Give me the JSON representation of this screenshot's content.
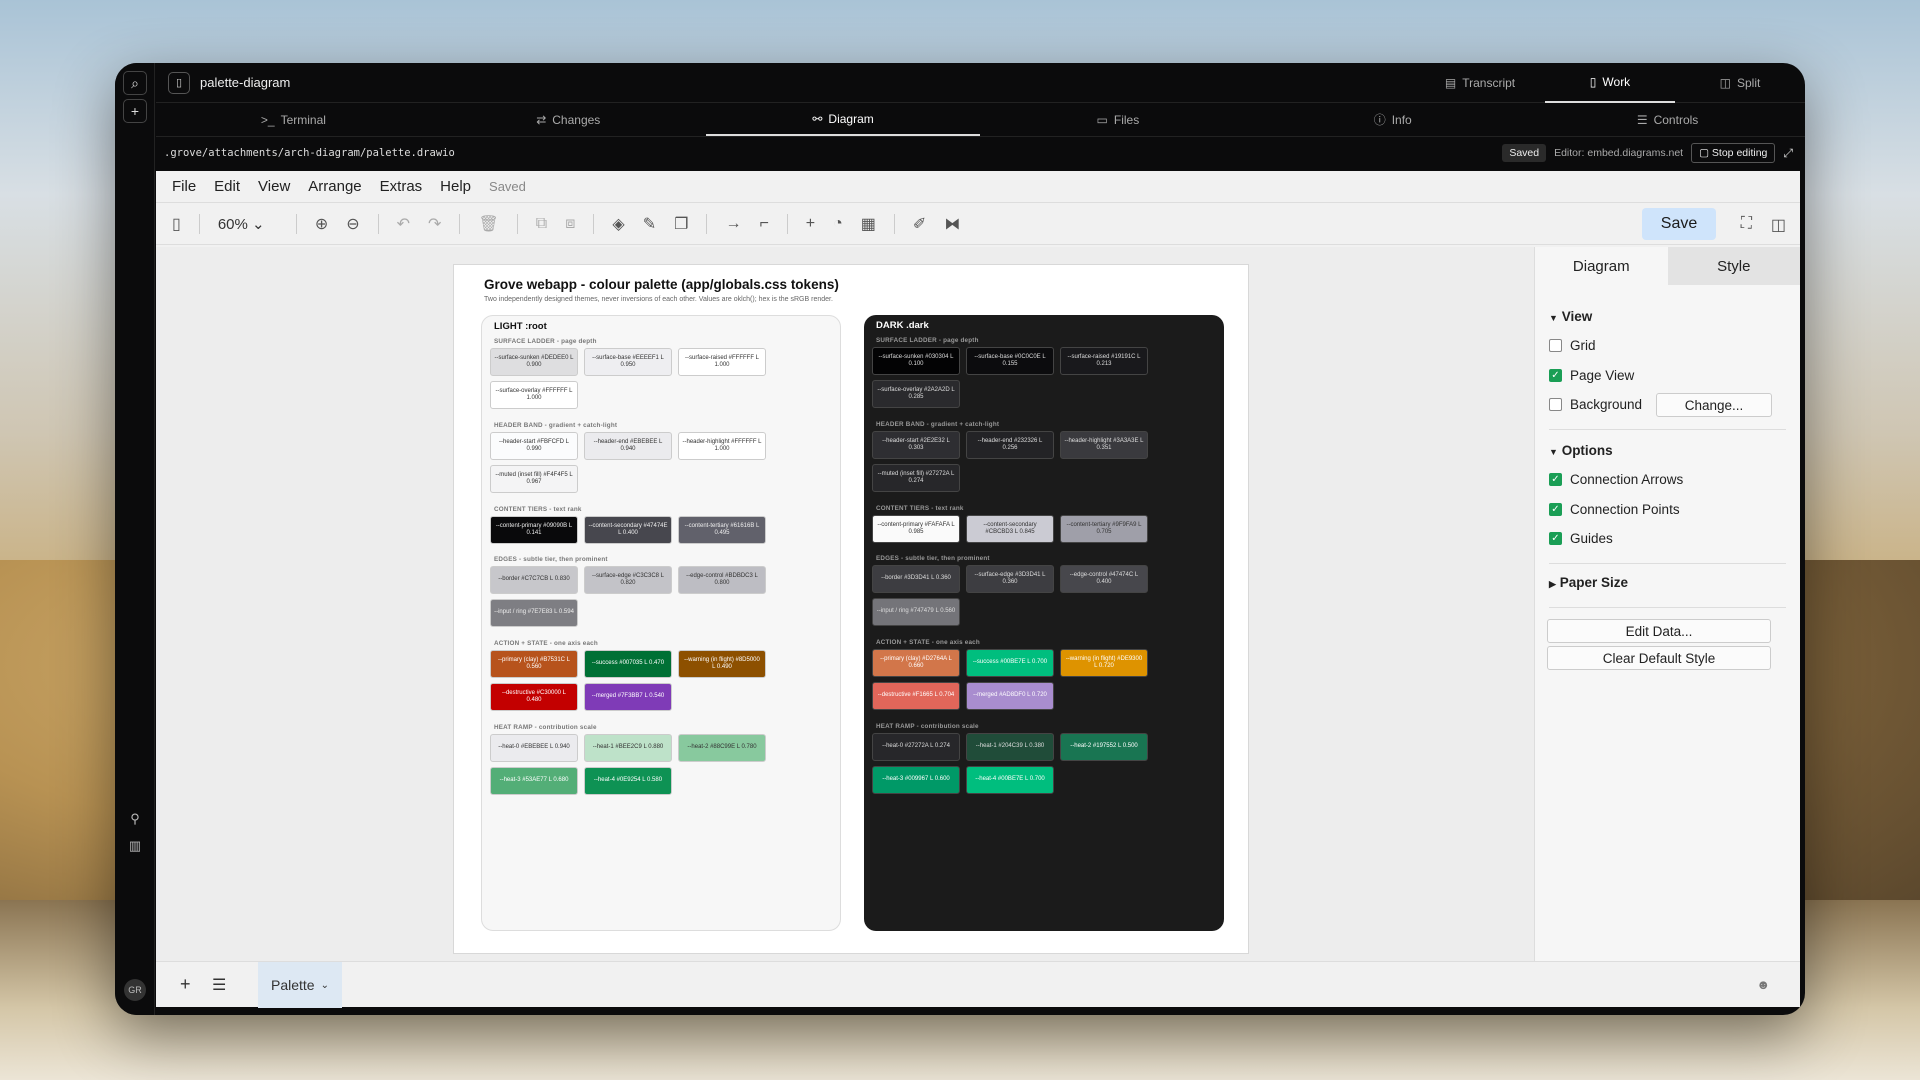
{
  "window": {
    "title": "palette-diagram"
  },
  "view_tabs": [
    {
      "label": "Transcript",
      "icon": "transcript-icon"
    },
    {
      "label": "Work",
      "icon": "work-icon",
      "active": true
    },
    {
      "label": "Split",
      "icon": "split-icon"
    }
  ],
  "tabs": [
    {
      "label": "Terminal",
      "icon": "terminal-icon"
    },
    {
      "label": "Changes",
      "icon": "changes-icon"
    },
    {
      "label": "Diagram",
      "icon": "diagram-icon",
      "active": true
    },
    {
      "label": "Files",
      "icon": "file-icon"
    },
    {
      "label": "Info",
      "icon": "info-icon"
    },
    {
      "label": "Controls",
      "icon": "controls-icon"
    }
  ],
  "path": {
    "file_path": ".grove/attachments/arch-diagram/palette.drawio",
    "saved_badge": "Saved",
    "editor_label": "Editor: embed.diagrams.net",
    "stop_label": "Stop editing"
  },
  "menu": {
    "items": [
      "File",
      "Edit",
      "View",
      "Arrange",
      "Extras",
      "Help"
    ],
    "status": "Saved"
  },
  "toolbar": {
    "zoom": "60%",
    "save_label": "Save"
  },
  "diagram": {
    "title": "Grove webapp - colour palette (app/globals.css tokens)",
    "subtitle": "Two independently designed themes, never inversions of each other. Values are oklch(); hex is the sRGB render.",
    "light": {
      "title": "LIGHT :root",
      "sections": [
        {
          "label": "SURFACE LADDER - page depth",
          "swatches": [
            {
              "text": "--surface-sunken #DEDEE0 L 0.900",
              "bg": "#DEDEE0",
              "fg": "#333"
            },
            {
              "text": "--surface-base #EEEEF1 L 0.950",
              "bg": "#EEEEF1",
              "fg": "#333"
            },
            {
              "text": "--surface-raised #FFFFFF L 1.000",
              "bg": "#FFFFFF",
              "fg": "#333"
            },
            {
              "text": "--surface-overlay #FFFFFF L 1.000",
              "bg": "#FFFFFF",
              "fg": "#333"
            }
          ]
        },
        {
          "label": "HEADER BAND - gradient + catch-light",
          "swatches": [
            {
              "text": "--header-start #FBFCFD L 0.990",
              "bg": "#FBFCFD",
              "fg": "#333"
            },
            {
              "text": "--header-end #EBEBEE L 0.940",
              "bg": "#EBEBEE",
              "fg": "#333"
            },
            {
              "text": "--header-highlight #FFFFFF L 1.000",
              "bg": "#FFFFFF",
              "fg": "#333"
            },
            {
              "text": "--muted (inset fill) #F4F4F5 L 0.967",
              "bg": "#F4F4F5",
              "fg": "#333"
            }
          ]
        },
        {
          "label": "CONTENT TIERS - text rank",
          "swatches": [
            {
              "text": "--content-primary #09090B L 0.141",
              "bg": "#09090B",
              "fg": "#eee"
            },
            {
              "text": "--content-secondary #47474E L 0.400",
              "bg": "#47474E",
              "fg": "#eee"
            },
            {
              "text": "--content-tertiary #61616B L 0.495",
              "bg": "#61616B",
              "fg": "#eee"
            }
          ]
        },
        {
          "label": "EDGES - subtle tier, then prominent",
          "swatches": [
            {
              "text": "--border #C7C7CB L 0.830",
              "bg": "#C7C7CB",
              "fg": "#333"
            },
            {
              "text": "--surface-edge #C3C3C8 L 0.820",
              "bg": "#C3C3C8",
              "fg": "#333"
            },
            {
              "text": "--edge-control #BDBDC3 L 0.800",
              "bg": "#BDBDC3",
              "fg": "#333"
            },
            {
              "text": "--input / ring #7E7E83 L 0.594",
              "bg": "#7E7E83",
              "fg": "#eee"
            }
          ]
        },
        {
          "label": "ACTION + STATE - one axis each",
          "swatches": [
            {
              "text": "--primary (clay) #B7531C L 0.560",
              "bg": "#B7531C",
              "fg": "#fff"
            },
            {
              "text": "--success #007035 L 0.470",
              "bg": "#007035",
              "fg": "#fff"
            },
            {
              "text": "--warning (in flight) #8D5000 L 0.490",
              "bg": "#8D5000",
              "fg": "#fff"
            },
            {
              "text": "--destructive #C30000 L 0.480",
              "bg": "#C30000",
              "fg": "#fff"
            },
            {
              "text": "--merged #7F3BB7 L 0.540",
              "bg": "#7F3BB7",
              "fg": "#fff"
            }
          ]
        },
        {
          "label": "HEAT RAMP - contribution scale",
          "swatches": [
            {
              "text": "--heat-0 #EBEBEE L 0.940",
              "bg": "#EBEBEE",
              "fg": "#333"
            },
            {
              "text": "--heat-1 #BEE2C9 L 0.880",
              "bg": "#BEE2C9",
              "fg": "#333"
            },
            {
              "text": "--heat-2 #88C99E L 0.780",
              "bg": "#88C99E",
              "fg": "#333"
            },
            {
              "text": "--heat-3 #53AE77 L 0.680",
              "bg": "#53AE77",
              "fg": "#fff"
            },
            {
              "text": "--heat-4 #0E9254 L 0.580",
              "bg": "#0E9254",
              "fg": "#fff"
            }
          ]
        }
      ]
    },
    "dark": {
      "title": "DARK .dark",
      "sections": [
        {
          "label": "SURFACE LADDER - page depth",
          "swatches": [
            {
              "text": "--surface-sunken #030304 L 0.100",
              "bg": "#030304",
              "fg": "#ddd"
            },
            {
              "text": "--surface-base #0C0C0E L 0.155",
              "bg": "#0C0C0E",
              "fg": "#ddd"
            },
            {
              "text": "--surface-raised #19191C L 0.213",
              "bg": "#19191C",
              "fg": "#ddd"
            },
            {
              "text": "--surface-overlay #2A2A2D L 0.285",
              "bg": "#2A2A2D",
              "fg": "#ddd"
            }
          ]
        },
        {
          "label": "HEADER BAND - gradient + catch-light",
          "swatches": [
            {
              "text": "--header-start #2E2E32 L 0.303",
              "bg": "#2E2E32",
              "fg": "#ddd"
            },
            {
              "text": "--header-end #232326 L 0.256",
              "bg": "#232326",
              "fg": "#ddd"
            },
            {
              "text": "--header-highlight #3A3A3E L 0.351",
              "bg": "#3A3A3E",
              "fg": "#ddd"
            },
            {
              "text": "--muted (inset fill) #27272A L 0.274",
              "bg": "#27272A",
              "fg": "#ddd"
            }
          ]
        },
        {
          "label": "CONTENT TIERS - text rank",
          "swatches": [
            {
              "text": "--content-primary #FAFAFA L 0.985",
              "bg": "#FAFAFA",
              "fg": "#333"
            },
            {
              "text": "--content-secondary #CBCBD3 L 0.845",
              "bg": "#CBCBD3",
              "fg": "#333"
            },
            {
              "text": "--content-tertiary #9F9FA9 L 0.705",
              "bg": "#9F9FA9",
              "fg": "#333"
            }
          ]
        },
        {
          "label": "EDGES - subtle tier, then prominent",
          "swatches": [
            {
              "text": "--border #3D3D41 L 0.360",
              "bg": "#3D3D41",
              "fg": "#ddd"
            },
            {
              "text": "--surface-edge #3D3D41 L 0.360",
              "bg": "#3D3D41",
              "fg": "#ddd"
            },
            {
              "text": "--edge-control #47474C L 0.400",
              "bg": "#47474C",
              "fg": "#ddd"
            },
            {
              "text": "--input / ring #747479 L 0.560",
              "bg": "#747479",
              "fg": "#ddd"
            }
          ]
        },
        {
          "label": "ACTION + STATE - one axis each",
          "swatches": [
            {
              "text": "--primary (clay) #D2764A L 0.660",
              "bg": "#D2764A",
              "fg": "#fff"
            },
            {
              "text": "--success #00BE7E L 0.700",
              "bg": "#00BE7E",
              "fg": "#fff"
            },
            {
              "text": "--warning (in flight) #DE9300 L 0.720",
              "bg": "#DE9300",
              "fg": "#fff"
            },
            {
              "text": "--destructive #F1665 L 0.704",
              "bg": "#E1665A",
              "fg": "#fff"
            },
            {
              "text": "--merged #AD8DF0 L 0.720",
              "bg": "#A98DCF",
              "fg": "#fff"
            }
          ]
        },
        {
          "label": "HEAT RAMP - contribution scale",
          "swatches": [
            {
              "text": "--heat-0 #27272A L 0.274",
              "bg": "#27272A",
              "fg": "#ddd"
            },
            {
              "text": "--heat-1 #204C39 L 0.380",
              "bg": "#204C39",
              "fg": "#ddd"
            },
            {
              "text": "--heat-2 #197552 L 0.500",
              "bg": "#197552",
              "fg": "#fff"
            },
            {
              "text": "--heat-3 #009967 L 0.600",
              "bg": "#009967",
              "fg": "#fff"
            },
            {
              "text": "--heat-4 #00BE7E L 0.700",
              "bg": "#00BE7E",
              "fg": "#fff"
            }
          ]
        }
      ]
    }
  },
  "format_panel": {
    "tabs": [
      "Diagram",
      "Style"
    ],
    "view_heading": "View",
    "grid": {
      "label": "Grid",
      "checked": false
    },
    "page_view": {
      "label": "Page View",
      "checked": true
    },
    "background": {
      "label": "Background",
      "checked": false,
      "button": "Change..."
    },
    "options_heading": "Options",
    "connection_arrows": {
      "label": "Connection Arrows",
      "checked": true
    },
    "connection_points": {
      "label": "Connection Points",
      "checked": true
    },
    "guides": {
      "label": "Guides",
      "checked": true
    },
    "paper_size_heading": "Paper Size",
    "edit_data": "Edit Data...",
    "clear_default_style": "Clear Default Style"
  },
  "bottom": {
    "page_tab": "Palette"
  },
  "rail": {
    "avatar": "GR"
  }
}
